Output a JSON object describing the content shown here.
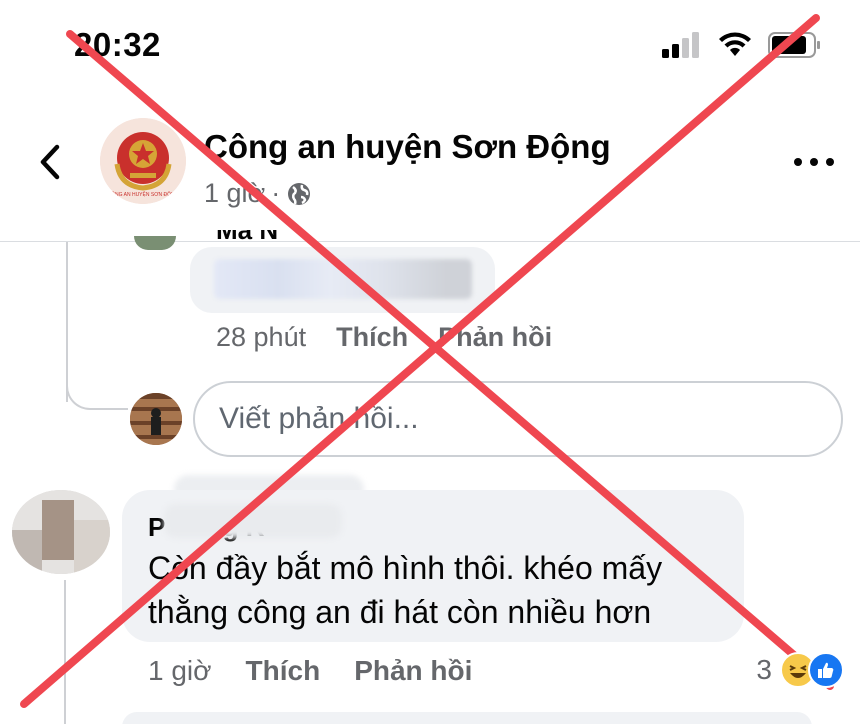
{
  "status_bar": {
    "time": "20:32",
    "icons": [
      "cellular-signal-icon",
      "wifi-icon",
      "battery-icon"
    ]
  },
  "header": {
    "back_icon": "chevron-left-icon",
    "page_name": "Công an huyện Sơn Động",
    "post_time": "1 giờ",
    "separator": "·",
    "audience_icon": "globe-icon",
    "more_icon": "more-horizontal-icon"
  },
  "reply": {
    "name_partial": "Ma N",
    "time": "28 phút",
    "like_label": "Thích",
    "reply_label": "Phản hồi"
  },
  "reply_input": {
    "placeholder": "Viết phản hồi..."
  },
  "comment": {
    "author_visible": "P        g R",
    "text": "Còn đầy bắt mô hình thôi. khéo mấy thằng công an đi hát còn nhiều hơn",
    "time": "1 giờ",
    "like_label": "Thích",
    "reply_label": "Phản hồi",
    "reaction_count": "3",
    "reaction_icons": [
      "haha-icon",
      "like-icon"
    ]
  },
  "colors": {
    "overlay_cross": "#f0464f",
    "secondary_text": "#65676b",
    "bubble_bg": "#f0f2f5",
    "like_blue": "#1877f2"
  }
}
